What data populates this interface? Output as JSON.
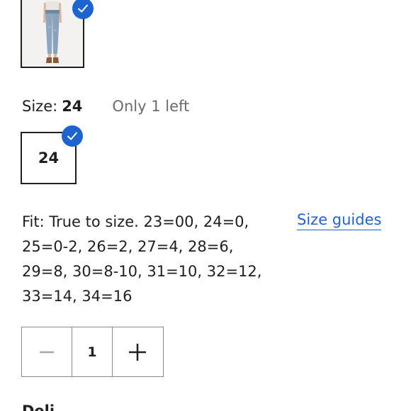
{
  "color": {
    "selected_swatch_icon": "jeans-product-thumbnail",
    "check_icon": "checkmark-icon"
  },
  "size": {
    "label": "Size:",
    "selected": "24",
    "stock_note": "Only 1 left",
    "options": [
      "24"
    ]
  },
  "fit": {
    "lines": [
      "Fit: True to size. 23=00, 24=0,",
      "25=0-2, 26=2, 27=4, 28=6,",
      "29=8, 30=8-10, 31=10, 32=12,",
      "33=14, 34=16"
    ],
    "size_guides_label": "Size guides"
  },
  "quantity": {
    "value": "1",
    "decrement_icon": "minus-icon",
    "increment_icon": "plus-icon"
  },
  "next_section": {
    "heading": "Deli"
  },
  "colors": {
    "accent": "#1d64d1",
    "text": "#1f1f1f",
    "muted": "#6b6b6b",
    "border": "#8a8a8a"
  }
}
